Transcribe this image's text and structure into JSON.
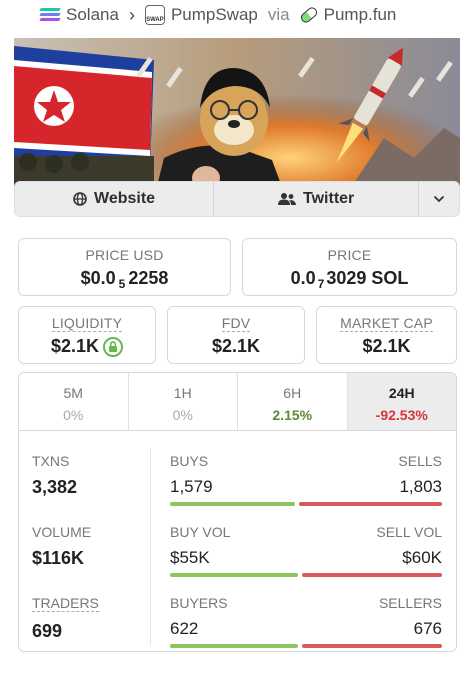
{
  "breadcrumb": {
    "chain": "Solana",
    "dex": "PumpSwap",
    "dex_badge": "SWAP",
    "via": "via",
    "launchpad": "Pump.fun"
  },
  "links": {
    "website": "Website",
    "twitter": "Twitter"
  },
  "price_usd": {
    "label": "PRICE USD",
    "prefix": "$0.0",
    "zeros": "5",
    "digits": "2258"
  },
  "price_native": {
    "label": "PRICE",
    "prefix": "0.0",
    "zeros": "7",
    "digits": "3029 SOL"
  },
  "liquidity": {
    "label": "LIQUIDITY",
    "value": "$2.1K"
  },
  "fdv": {
    "label": "FDV",
    "value": "$2.1K"
  },
  "market_cap": {
    "label": "MARKET CAP",
    "value": "$2.1K"
  },
  "tabs": [
    {
      "label": "5M",
      "value": "0%"
    },
    {
      "label": "1H",
      "value": "0%"
    },
    {
      "label": "6H",
      "value": "2.15%"
    },
    {
      "label": "24H",
      "value": "-92.53%"
    }
  ],
  "txns": {
    "label": "TXNS",
    "value": "3,382",
    "left_label": "BUYS",
    "left_value": "1,579",
    "right_label": "SELLS",
    "right_value": "1,803",
    "buy_fraction": 0.467
  },
  "volume": {
    "label": "VOLUME",
    "value": "$116K",
    "left_label": "BUY VOL",
    "left_value": "$55K",
    "right_label": "SELL VOL",
    "right_value": "$60K",
    "buy_fraction": 0.478
  },
  "traders": {
    "label": "TRADERS",
    "value": "699",
    "left_label": "BUYERS",
    "left_value": "622",
    "right_label": "SELLERS",
    "right_value": "676",
    "buy_fraction": 0.479
  },
  "colors": {
    "positive": "#5c8a3a",
    "negative": "#d9333a",
    "buy_bar": "#8cc45f",
    "sell_bar": "#d95a5a"
  },
  "icons": [
    "globe-icon",
    "users-icon",
    "chevron-down-icon",
    "lock-icon",
    "solana-icon",
    "pill-icon"
  ]
}
